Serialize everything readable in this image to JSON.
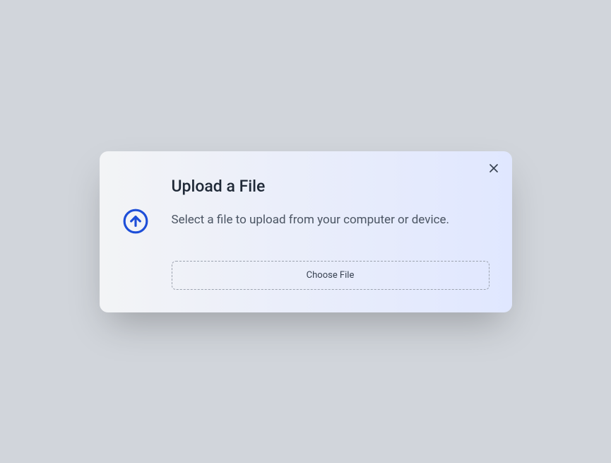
{
  "modal": {
    "title": "Upload a File",
    "description": "Select a file to upload from your computer or device.",
    "chooseFileLabel": "Choose File"
  }
}
